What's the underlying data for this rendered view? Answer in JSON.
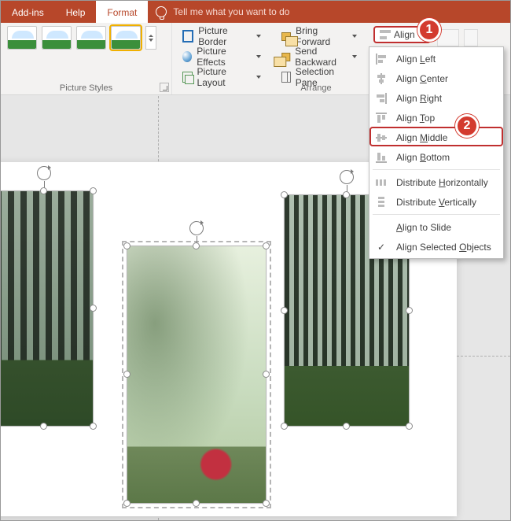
{
  "tabs": {
    "addins": "Add-ins",
    "help": "Help",
    "format": "Format"
  },
  "tell_me": "Tell me what you want to do",
  "groups": {
    "picture_styles": "Picture Styles",
    "arrange": "Arrange",
    "border": "Picture Border",
    "effects": "Picture Effects",
    "layout": "Picture Layout",
    "bring_forward": "Bring Forward",
    "send_backward": "Send Backward",
    "selection_pane": "Selection Pane",
    "align": "Align"
  },
  "callouts": {
    "one": "1",
    "two": "2"
  },
  "menu": {
    "left": {
      "pre": "Align ",
      "u": "L",
      "post": "eft"
    },
    "center": {
      "pre": "Align ",
      "u": "C",
      "post": "enter"
    },
    "right": {
      "pre": "Align ",
      "u": "R",
      "post": "ight"
    },
    "top": {
      "pre": "Align ",
      "u": "T",
      "post": "op"
    },
    "middle": {
      "pre": "Align ",
      "u": "M",
      "post": "iddle"
    },
    "bottom": {
      "pre": "Align ",
      "u": "B",
      "post": "ottom"
    },
    "dist_h": {
      "pre": "Distribute ",
      "u": "H",
      "post": "orizontally"
    },
    "dist_v": {
      "pre": "Distribute ",
      "u": "V",
      "post": "ertically"
    },
    "to_slide": {
      "pre": "",
      "u": "A",
      "post": "lign to Slide"
    },
    "sel_obj": {
      "pre": "Align Selected ",
      "u": "O",
      "post": "bjects"
    }
  }
}
